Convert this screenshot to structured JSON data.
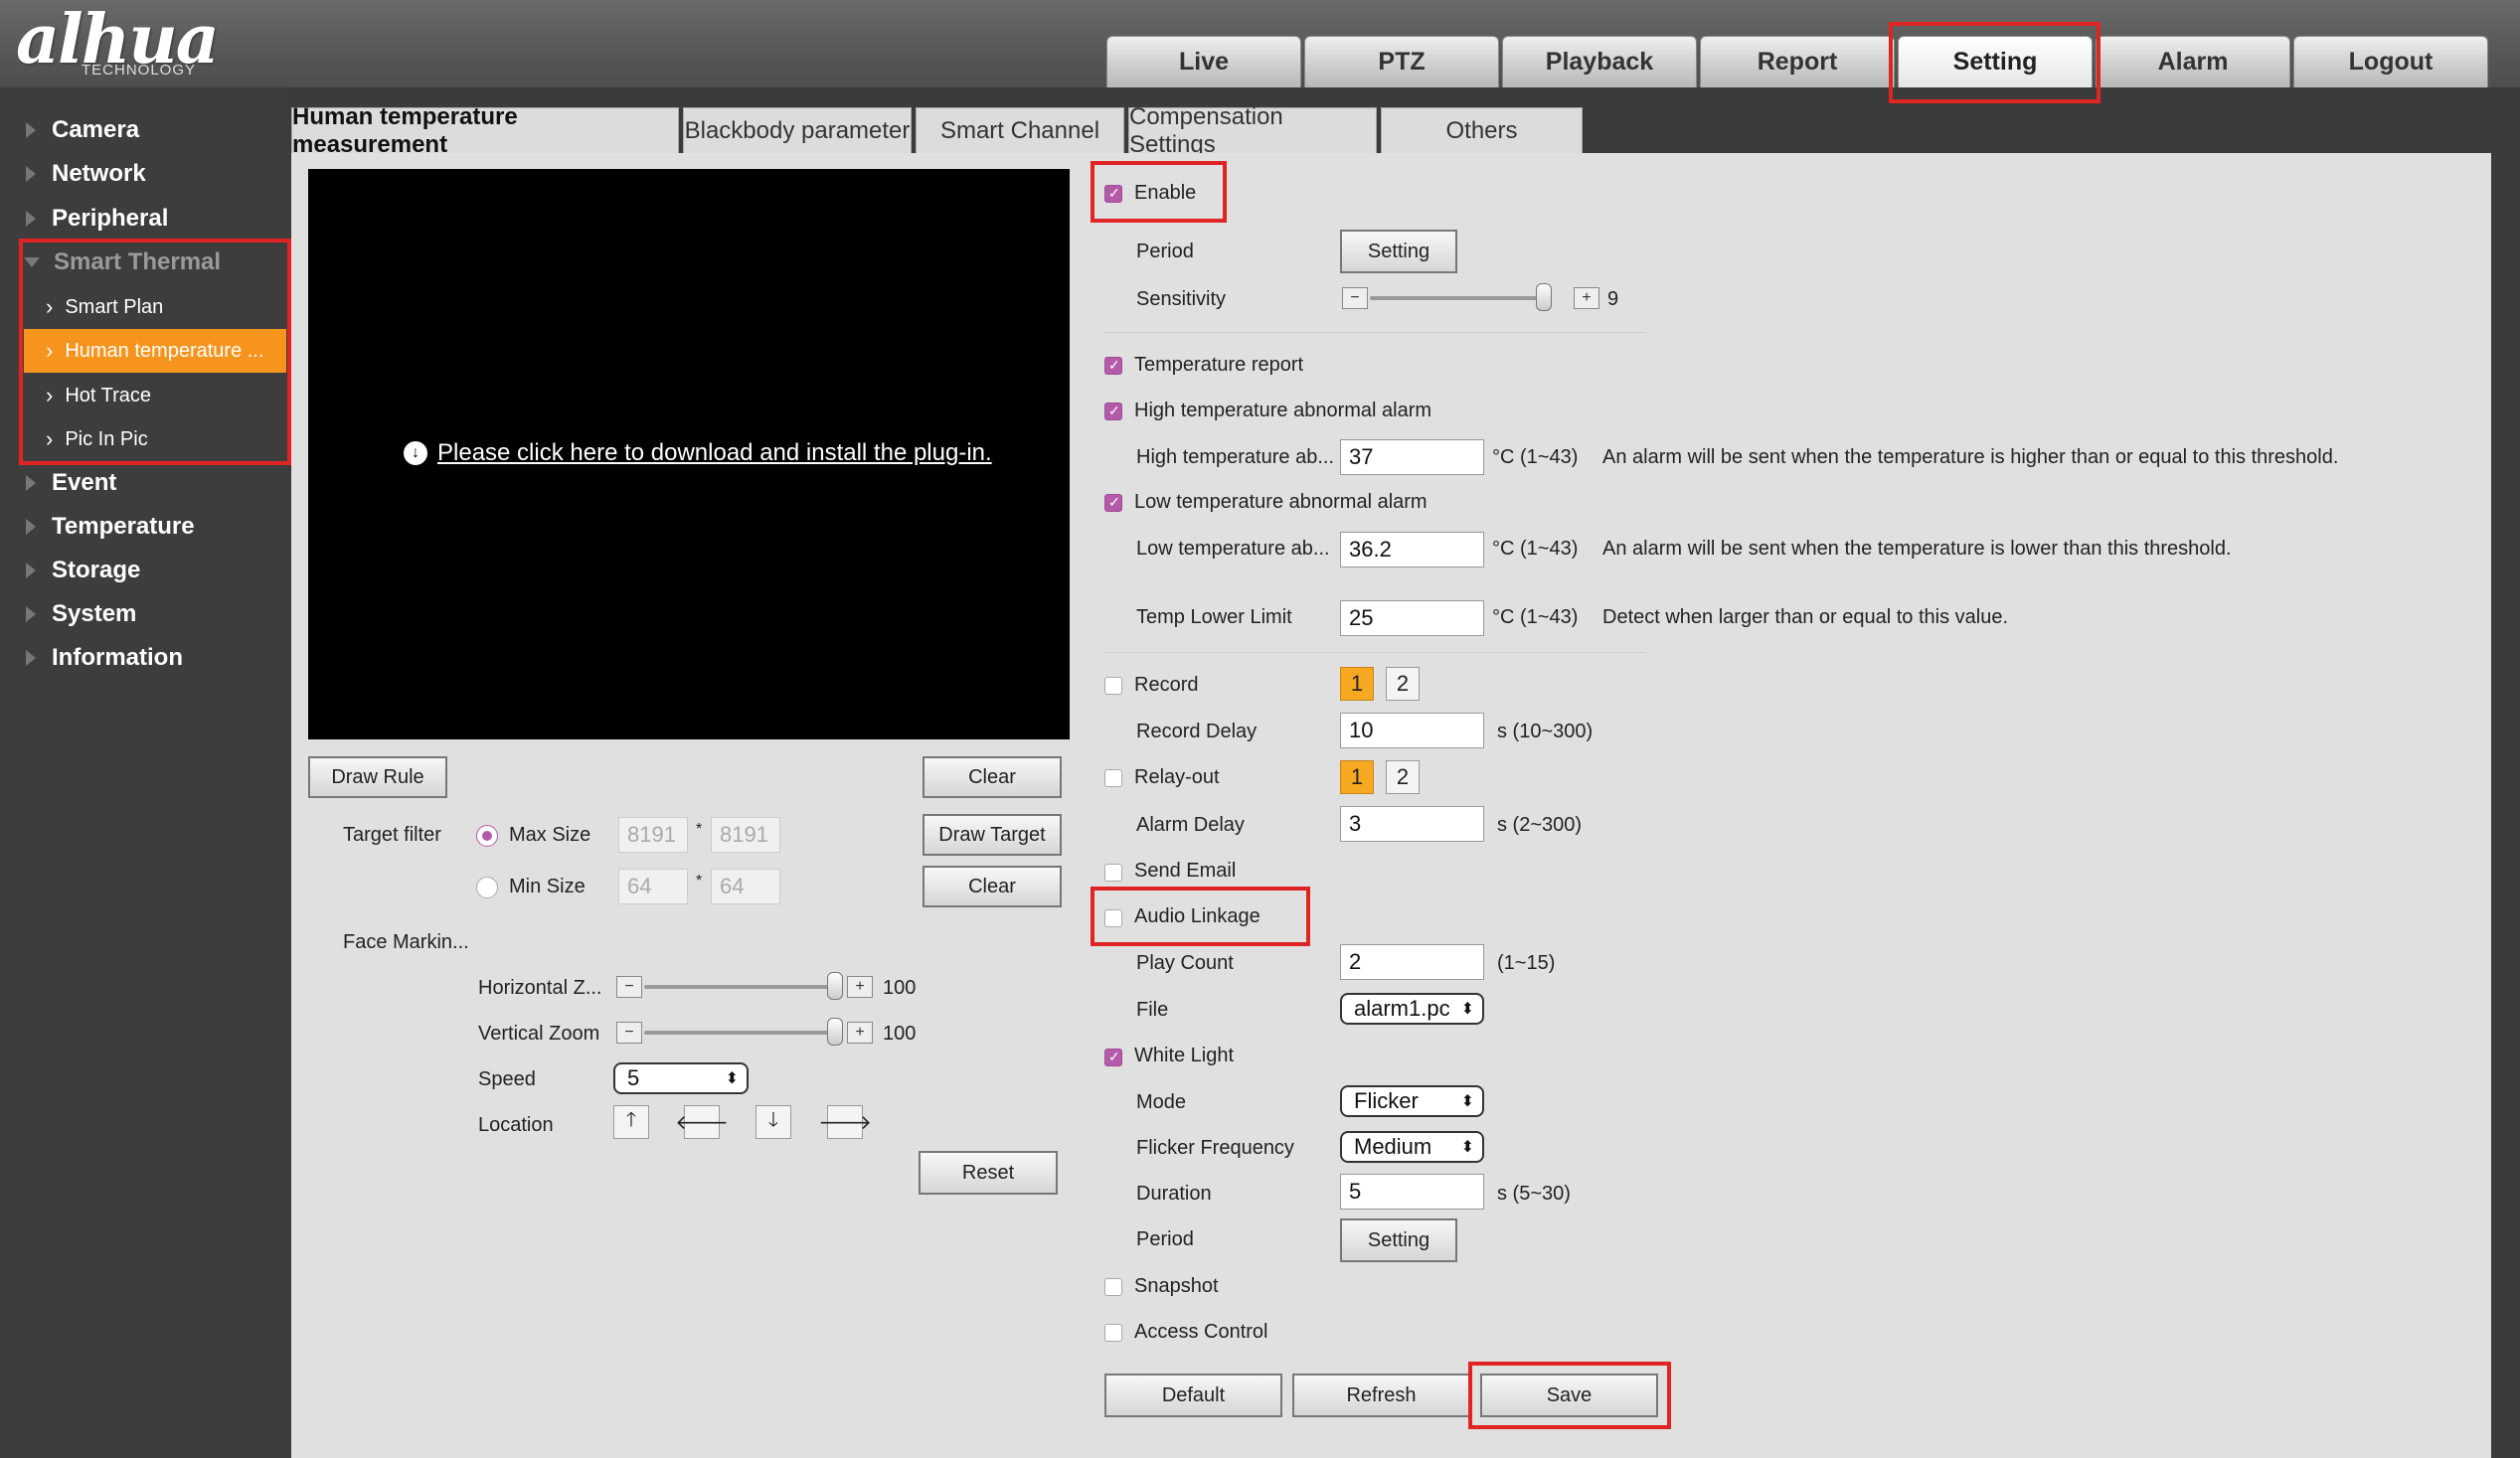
{
  "brand": {
    "logo": "alhua",
    "logo_sub": "TECHNOLOGY"
  },
  "nav": {
    "tabs": [
      {
        "label": "Live"
      },
      {
        "label": "PTZ"
      },
      {
        "label": "Playback"
      },
      {
        "label": "Report"
      },
      {
        "label": "Setting"
      },
      {
        "label": "Alarm"
      },
      {
        "label": "Logout"
      }
    ],
    "active": "Setting"
  },
  "sidebar": {
    "items": [
      {
        "label": "Camera"
      },
      {
        "label": "Network"
      },
      {
        "label": "Peripheral"
      },
      {
        "label": "Smart Thermal"
      },
      {
        "label": "Event"
      },
      {
        "label": "Temperature"
      },
      {
        "label": "Storage"
      },
      {
        "label": "System"
      },
      {
        "label": "Information"
      }
    ],
    "sub_items": [
      {
        "label": "Smart Plan"
      },
      {
        "label": "Human temperature ..."
      },
      {
        "label": "Hot Trace"
      },
      {
        "label": "Pic In Pic"
      }
    ]
  },
  "subtabs": [
    {
      "label": "Human temperature measurement"
    },
    {
      "label": "Blackbody parameter"
    },
    {
      "label": "Smart Channel"
    },
    {
      "label": "Compensation Settings"
    },
    {
      "label": "Others"
    }
  ],
  "video": {
    "plugin_text": "Please click here to download and install the plug-in."
  },
  "left_controls": {
    "draw_rule": "Draw Rule",
    "clear1": "Clear",
    "draw_target": "Draw Target",
    "clear2": "Clear",
    "target_filter": "Target filter",
    "max_size": "Max Size",
    "min_size": "Min Size",
    "max_w": "8191",
    "max_h": "8191",
    "min_w": "64",
    "min_h": "64",
    "sep": "*",
    "face_marking": "Face Markin...",
    "horizontal_zoom": "Horizontal Z...",
    "horizontal_zoom_value": "100",
    "vertical_zoom": "Vertical Zoom",
    "vertical_zoom_value": "100",
    "speed": "Speed",
    "speed_value": "5",
    "location": "Location",
    "reset": "Reset"
  },
  "right_controls": {
    "enable": "Enable",
    "period": "Period",
    "period_btn": "Setting",
    "sensitivity": "Sensitivity",
    "sensitivity_value": "9",
    "temp_report": "Temperature report",
    "high_alarm": "High temperature abnormal alarm",
    "high_label": "High temperature ab...",
    "high_value": "37",
    "high_range": "°C (1~43)",
    "high_note": "An alarm will be sent when the temperature is higher than or equal to this threshold.",
    "low_alarm": "Low temperature abnormal alarm",
    "low_label": "Low temperature ab...",
    "low_value": "36.2",
    "low_range": "°C (1~43)",
    "low_note": "An alarm will be sent when the temperature is lower than this threshold.",
    "lower_limit": "Temp Lower Limit",
    "lower_value": "25",
    "lower_range": "°C (1~43)",
    "lower_note": "Detect when larger than or equal to this value.",
    "record": "Record",
    "record_delay": "Record Delay",
    "record_delay_value": "10",
    "record_delay_range": "s (10~300)",
    "relay_out": "Relay-out",
    "alarm_delay": "Alarm Delay",
    "alarm_delay_value": "3",
    "alarm_delay_range": "s (2~300)",
    "send_email": "Send Email",
    "audio_linkage": "Audio Linkage",
    "play_count": "Play Count",
    "play_count_value": "2",
    "play_count_range": "(1~15)",
    "file": "File",
    "file_value": "alarm1.pc",
    "white_light": "White Light",
    "mode": "Mode",
    "mode_value": "Flicker",
    "flicker_freq": "Flicker Frequency",
    "flicker_value": "Medium",
    "duration": "Duration",
    "duration_value": "5",
    "duration_range": "s (5~30)",
    "period2": "Period",
    "period2_btn": "Setting",
    "snapshot": "Snapshot",
    "access_control": "Access Control",
    "ch1": "1",
    "ch2": "2"
  },
  "footer": {
    "default": "Default",
    "refresh": "Refresh",
    "save": "Save"
  },
  "colors": {
    "accent": "#f7941d",
    "highlight": "#e02424",
    "check": "#b35aaa"
  }
}
